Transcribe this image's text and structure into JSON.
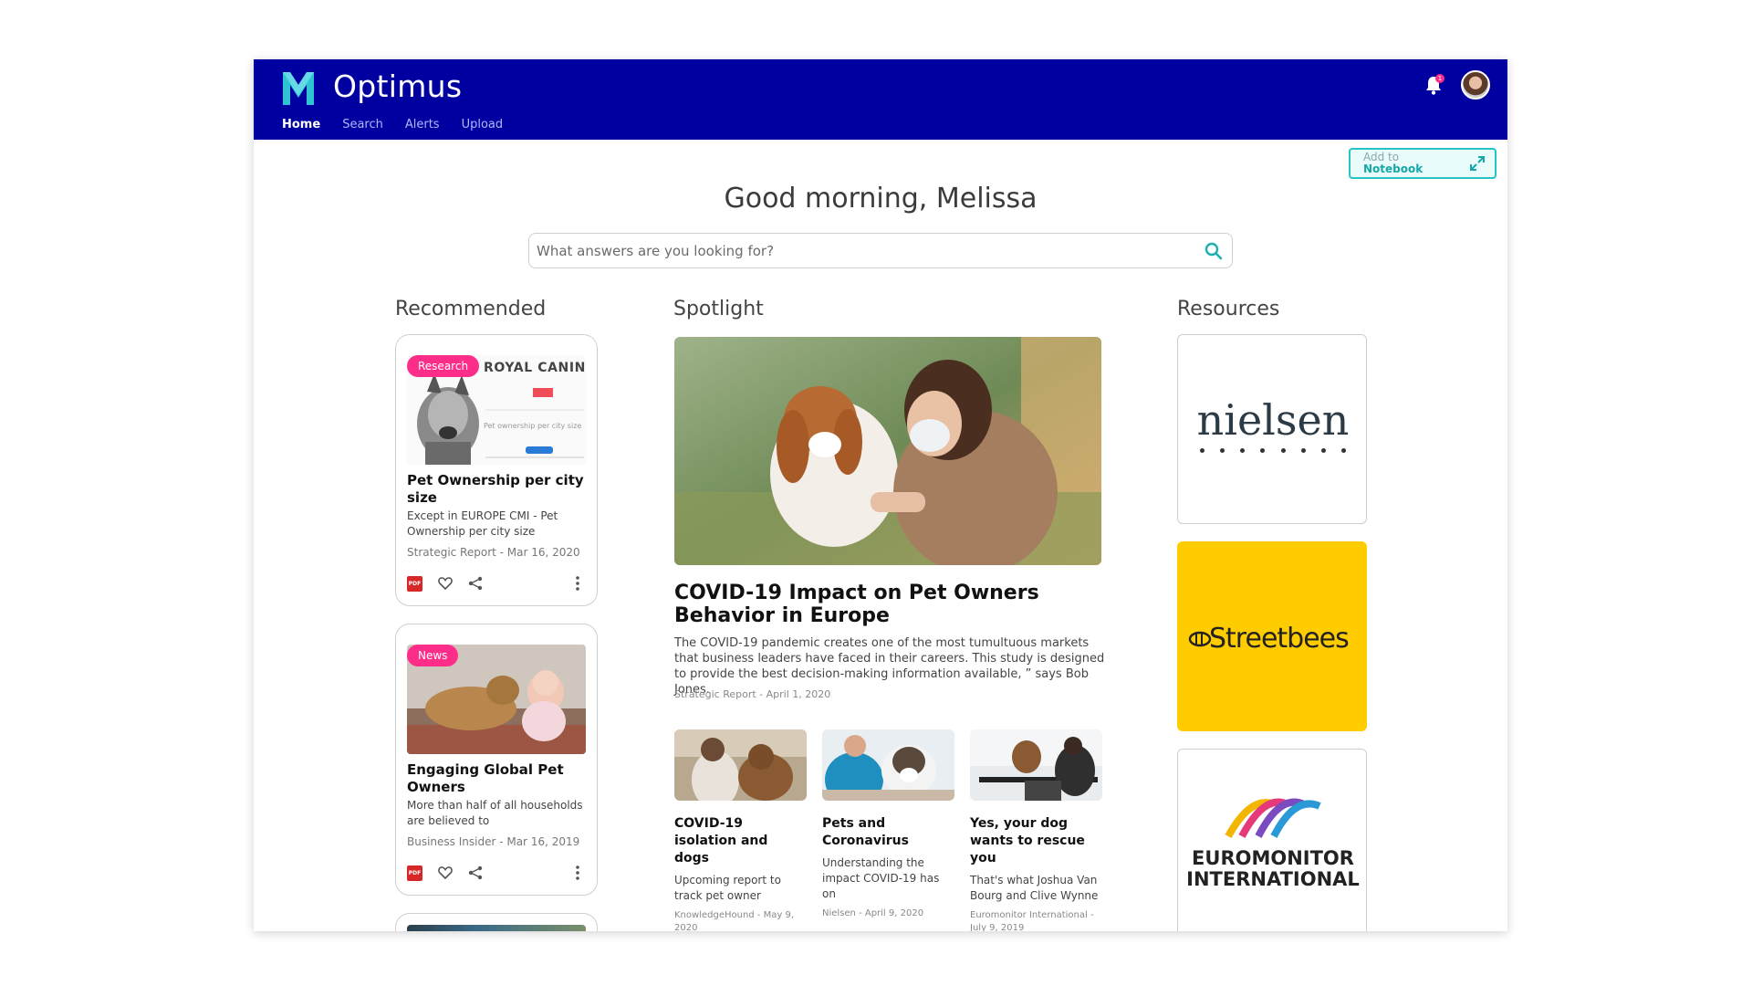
{
  "app": {
    "title": "Optimus"
  },
  "nav": {
    "items": [
      "Home",
      "Search",
      "Alerts",
      "Upload"
    ],
    "active": "Home"
  },
  "header": {
    "notification_count": "1"
  },
  "add_notebook": {
    "line1": "Add to",
    "line2": "Notebook"
  },
  "greeting": "Good morning, Melissa",
  "search": {
    "placeholder": "What answers are you looking for?"
  },
  "columns": {
    "recommended": "Recommended",
    "spotlight": "Spotlight",
    "resources": "Resources"
  },
  "recommended": [
    {
      "badge": "Research",
      "thumb_text": "ROYAL CANIN",
      "thumb_sub": "Pet ownership per city size",
      "title": "Pet Ownership per city size",
      "desc": "Except in EUROPE CMI - Pet Ownership per city size",
      "meta": "Strategic Report - Mar 16, 2020",
      "file_icon": "PDF"
    },
    {
      "badge": "News",
      "title": "Engaging Global Pet Owners",
      "desc": "More than half of all households are believed to",
      "meta": "Business Insider - Mar 16, 2019",
      "file_icon": "PDF"
    }
  ],
  "spotlight": {
    "title": "COVID-19 Impact on Pet Owners Behavior in Europe",
    "desc": "The COVID-19 pandemic creates one of the most tumultuous markets that business leaders have faced in their careers. This study is designed to provide the best decision-making information available, ” says Bob Jones.",
    "meta": "Strategic Report - April 1, 2020",
    "items": [
      {
        "title": "COVID-19 isolation and dogs",
        "desc": "Upcoming report to track pet owner",
        "meta": "KnowledgeHound - May 9, 2020"
      },
      {
        "title": "Pets and Coronavirus",
        "desc": "Understanding the impact COVID-19 has on",
        "meta": "Nielsen - April 9, 2020"
      },
      {
        "title": "Yes, your dog wants to rescue you",
        "desc": "That's what Joshua Van Bourg and Clive Wynne",
        "meta": "Euromonitor International - July 9, 2019"
      }
    ]
  },
  "resources": [
    {
      "name": "nielsen"
    },
    {
      "name": "Streetbees"
    },
    {
      "name_line1": "EUROMONITOR",
      "name_line2": "INTERNATIONAL"
    }
  ],
  "colors": {
    "header": "#0000a0",
    "accent": "#ff2d8a",
    "teal": "#28c3c3",
    "streetbees_bg": "#ffcc00"
  }
}
